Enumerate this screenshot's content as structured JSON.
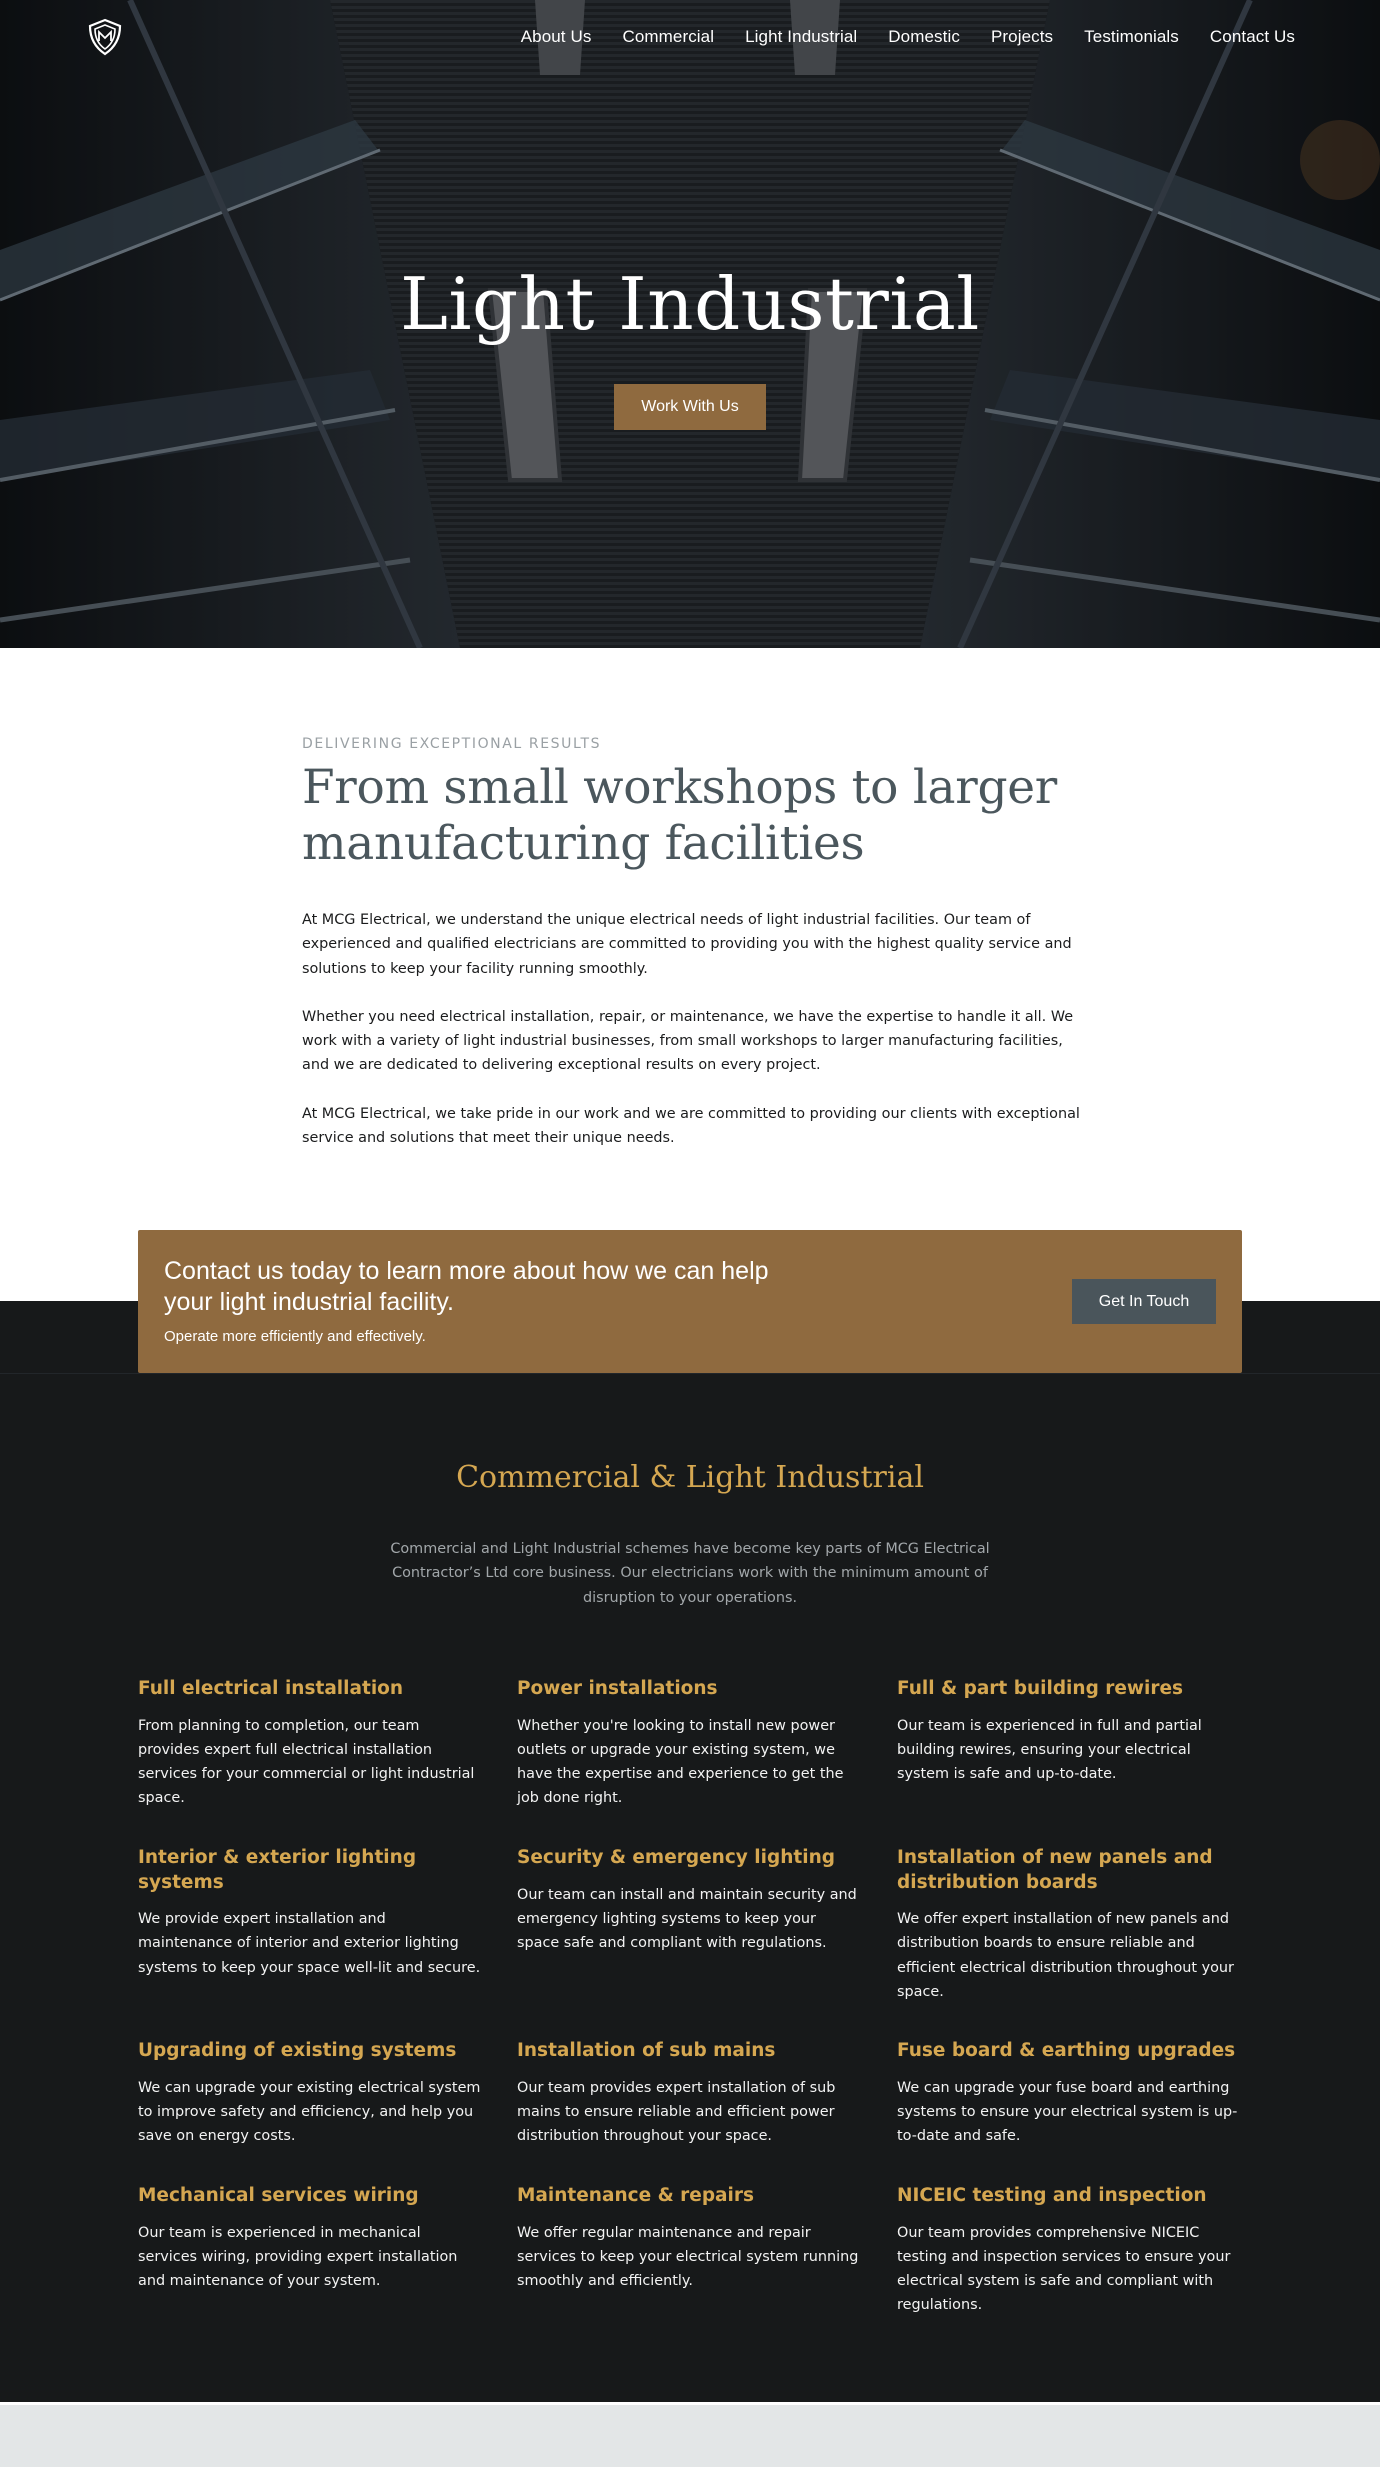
{
  "nav": {
    "links": [
      "About Us",
      "Commercial",
      "Light Industrial",
      "Domestic",
      "Projects",
      "Testimonials",
      "Contact Us"
    ]
  },
  "hero": {
    "title": "Light Industrial",
    "cta": "Work With Us"
  },
  "intro": {
    "eyebrow": "DELIVERING EXCEPTIONAL RESULTS",
    "title": "From small workshops to larger manufacturing facilities",
    "paragraphs": [
      "At MCG Electrical, we understand the unique electrical needs of light industrial facilities. Our team of experienced and qualified electricians are committed to providing you with the highest quality service and solutions to keep your facility running smoothly.",
      "Whether you need electrical installation, repair, or maintenance, we have the expertise to handle it all. We work with a variety of light industrial businesses, from small workshops to larger manufacturing facilities, and we are dedicated to delivering exceptional results on every project.",
      "At MCG Electrical, we take pride in our work and we are committed to providing our clients with exceptional service and solutions that meet their unique needs."
    ]
  },
  "cta_band": {
    "title": "Contact us today to learn more about how we can help your light industrial facility.",
    "subtitle": "Operate more efficiently and effectively.",
    "button": "Get In Touch"
  },
  "services": {
    "title": "Commercial & Light Industrial",
    "description": "Commercial and Light Industrial schemes have become key parts of MCG Electrical Contractor’s Ltd core business. Our electricians work with the minimum amount of disruption to your operations.",
    "items": [
      {
        "title": "Full electrical installation",
        "desc": "From planning to completion, our team provides expert full electrical installation services for your commercial or light industrial space."
      },
      {
        "title": "Power installations",
        "desc": "Whether you're looking to install new power outlets or upgrade your existing system, we have the expertise and experience to get the job done right."
      },
      {
        "title": "Full & part building rewires",
        "desc": "Our team is experienced in full and partial building rewires, ensuring your electrical system is safe and up-to-date."
      },
      {
        "title": "Interior & exterior lighting systems",
        "desc": "We provide expert installation and maintenance of interior and exterior lighting systems to keep your space well-lit and secure."
      },
      {
        "title": "Security & emergency lighting",
        "desc": "Our team can install and maintain security and emergency lighting systems to keep your space safe and compliant with regulations."
      },
      {
        "title": "Installation of new panels and distribution boards",
        "desc": "We offer expert installation of new panels and distribution boards to ensure reliable and efficient electrical distribution throughout your space."
      },
      {
        "title": "Upgrading of existing systems",
        "desc": "We can upgrade your existing electrical system to improve safety and efficiency, and help you save on energy costs."
      },
      {
        "title": "Installation of sub mains",
        "desc": "Our team provides expert installation of sub mains to ensure reliable and efficient power distribution throughout your space."
      },
      {
        "title": "Fuse board & earthing upgrades",
        "desc": "We can upgrade your fuse board and earthing systems to ensure your electrical system is up-to-date and safe."
      },
      {
        "title": "Mechanical services wiring",
        "desc": "Our team is experienced in mechanical services wiring, providing expert installation and maintenance of your system."
      },
      {
        "title": "Maintenance & repairs",
        "desc": "We offer regular maintenance and repair services to keep your electrical system running smoothly and efficiently."
      },
      {
        "title": "NICEIC testing and inspection",
        "desc": "Our team provides comprehensive NICEIC testing and inspection services to ensure your electrical system is safe and compliant with regulations."
      }
    ]
  },
  "colors": {
    "accent_gold": "#8f6a3f",
    "heading_gold": "#d5a751",
    "dark_bg": "#17191a",
    "slate_button": "#4a555b",
    "intro_heading": "#4b575d"
  },
  "icons": {
    "logo": "shield-logo-icon"
  }
}
